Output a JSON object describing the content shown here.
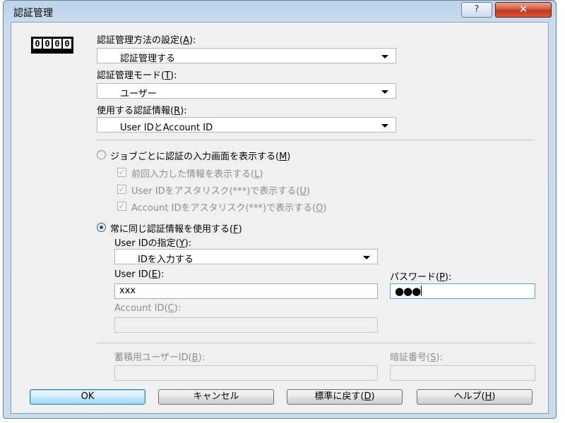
{
  "window": {
    "title": "認証管理",
    "help_button": "?",
    "close_button": "✕"
  },
  "counter_icon_digits": [
    "0",
    "0",
    "0",
    "0"
  ],
  "auth_method": {
    "label": "認証管理方法の設定(",
    "key": "A",
    "label_end": "):",
    "value": "認証管理する"
  },
  "auth_mode": {
    "label": "認証管理モード(",
    "key": "T",
    "label_end": "):",
    "value": "ユーザー"
  },
  "auth_info": {
    "label": "使用する認証情報(",
    "key": "R",
    "label_end": "):",
    "value": "User IDとAccount ID"
  },
  "per_job_option": {
    "label": "ジョブごとに認証の入力画面を表示する(",
    "key": "M",
    "label_end": ")",
    "selected": false,
    "checkboxes": [
      {
        "label": "前回入力した情報を表示する(",
        "key": "L",
        "label_end": ")",
        "checked": true
      },
      {
        "label": "User IDをアスタリスク(***)で表示する(",
        "key": "U",
        "label_end": ")",
        "checked": true
      },
      {
        "label": "Account IDをアスタリスク(***)で表示する(",
        "key": "O",
        "label_end": ")",
        "checked": true
      }
    ]
  },
  "always_option": {
    "label": "常に同じ認証情報を使用する(",
    "key": "F",
    "label_end": ")",
    "selected": true
  },
  "user_id_spec": {
    "label": "User IDの指定(",
    "key": "Y",
    "label_end": "):",
    "value": "IDを入力する"
  },
  "user_id": {
    "label": "User ID(",
    "key": "E",
    "label_end": "):",
    "value": "xxx"
  },
  "password": {
    "label": "パスワード(",
    "key": "P",
    "label_end": "):",
    "value": "●●●"
  },
  "account_id": {
    "label": "Account ID(",
    "key": "C",
    "label_end": "):",
    "value": ""
  },
  "storage_user_id": {
    "label": "蓄積用ユーザーID(",
    "key": "B",
    "label_end": "):",
    "value": ""
  },
  "pin": {
    "label": "暗証番号(",
    "key": "S",
    "label_end": "):",
    "value": ""
  },
  "buttons": {
    "ok": "OK",
    "cancel": "キャンセル",
    "reset": "標準に戻す(",
    "reset_key": "D",
    "reset_end": ")",
    "help": "ヘルプ(",
    "help_key": "H",
    "help_end": ")"
  },
  "colors": {
    "title_gradient_top": "#bcd2ea",
    "close_button": "#c2361c",
    "default_button": "#bee6fd",
    "focus_border": "#5aa5dc"
  }
}
